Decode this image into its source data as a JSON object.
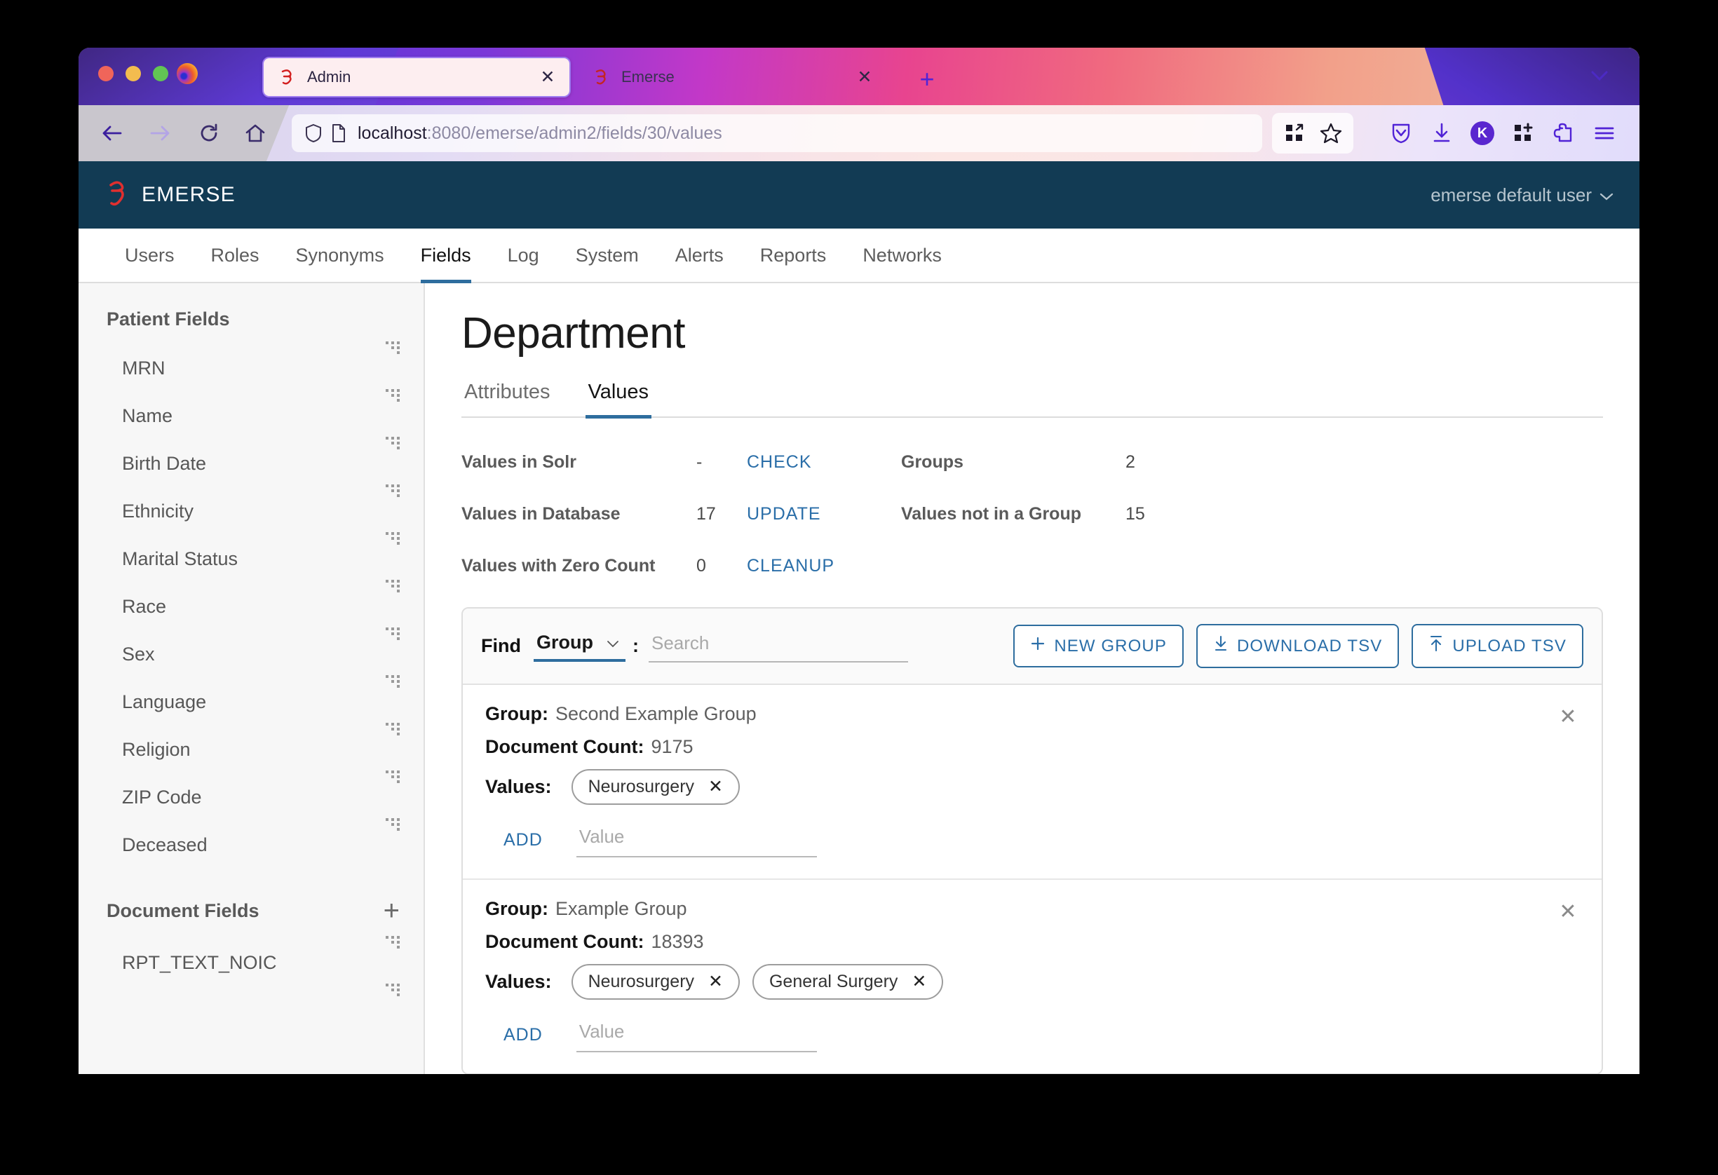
{
  "browser": {
    "tabs": [
      {
        "title": "Admin",
        "favicon": "emerse-icon",
        "active": true
      },
      {
        "title": "Emerse",
        "favicon": "emerse-icon",
        "active": false
      }
    ],
    "url_host": "localhost",
    "url_path": ":8080/emerse/admin2/fields/30/values",
    "new_tab_label": "+",
    "close_label": "✕",
    "toolbar_icons": [
      "extensions-grid-icon",
      "bookmark-star-icon",
      "pocket-save-icon",
      "downloads-icon",
      "account-avatar-icon",
      "add-extension-icon",
      "extensions-puzzle-icon",
      "app-menu-icon"
    ],
    "account_initial": "K"
  },
  "app": {
    "brand": "EMERSE",
    "user_menu": "emerse default user",
    "nav_tabs": [
      {
        "label": "Users",
        "active": false
      },
      {
        "label": "Roles",
        "active": false
      },
      {
        "label": "Synonyms",
        "active": false
      },
      {
        "label": "Fields",
        "active": true
      },
      {
        "label": "Log",
        "active": false
      },
      {
        "label": "System",
        "active": false
      },
      {
        "label": "Alerts",
        "active": false
      },
      {
        "label": "Reports",
        "active": false
      },
      {
        "label": "Networks",
        "active": false
      }
    ]
  },
  "sidebar": {
    "patient_fields_title": "Patient Fields",
    "patient_fields": [
      {
        "label": "MRN"
      },
      {
        "label": "Name"
      },
      {
        "label": "Birth Date"
      },
      {
        "label": "Ethnicity"
      },
      {
        "label": "Marital Status"
      },
      {
        "label": "Race"
      },
      {
        "label": "Sex"
      },
      {
        "label": "Language"
      },
      {
        "label": "Religion"
      },
      {
        "label": "ZIP Code"
      },
      {
        "label": "Deceased"
      }
    ],
    "document_fields_title": "Document Fields",
    "document_fields_add": "+",
    "document_fields": [
      {
        "label": "RPT_TEXT_NOIC"
      }
    ]
  },
  "main": {
    "page_title": "Department",
    "sub_tabs": [
      {
        "label": "Attributes",
        "active": false
      },
      {
        "label": "Values",
        "active": true
      }
    ],
    "stats": [
      {
        "label": "Values in Solr",
        "value": "-",
        "action": "CHECK",
        "label2": "Groups",
        "value2": "2"
      },
      {
        "label": "Values in Database",
        "value": "17",
        "action": "UPDATE",
        "label2": "Values not in a Group",
        "value2": "15"
      },
      {
        "label": "Values with Zero Count",
        "value": "0",
        "action": "CLEANUP",
        "label2": "",
        "value2": ""
      }
    ],
    "find": {
      "label": "Find",
      "select_value": "Group",
      "colon": ":",
      "search_placeholder": "Search"
    },
    "buttons": {
      "new_group": "NEW GROUP",
      "download_tsv": "DOWNLOAD TSV",
      "upload_tsv": "UPLOAD TSV"
    },
    "group_key": "Group:",
    "doc_count_key": "Document Count:",
    "values_key": "Values:",
    "add_label": "ADD",
    "value_placeholder": "Value",
    "close_label": "✕",
    "groups": [
      {
        "name": "Second Example Group",
        "document_count": "9175",
        "values": [
          "Neurosurgery"
        ]
      },
      {
        "name": "Example Group",
        "document_count": "18393",
        "values": [
          "Neurosurgery",
          "General Surgery"
        ]
      }
    ]
  },
  "colors": {
    "app_header": "#123b54",
    "accent_blue": "#2e6d9e",
    "link_blue": "#2a6ea8",
    "brand_red": "#d92b2b"
  }
}
